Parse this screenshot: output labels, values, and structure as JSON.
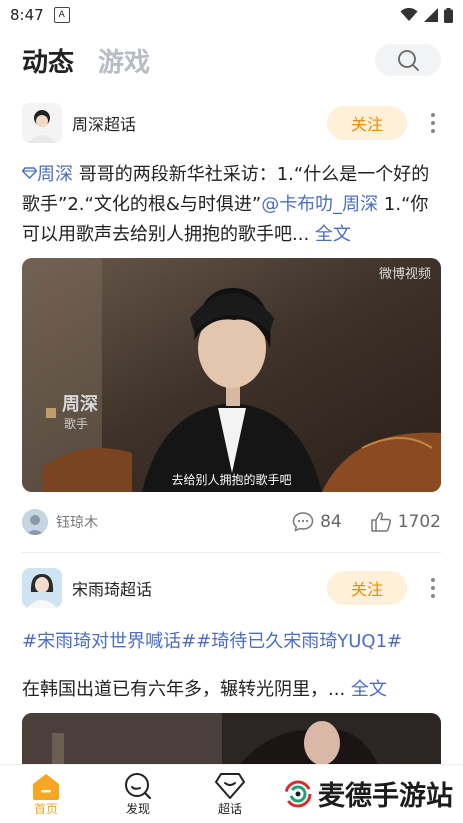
{
  "status_bar": {
    "time": "8:47",
    "app_icon_letter": "A"
  },
  "header": {
    "tab_active": "动态",
    "tab_inactive": "游戏"
  },
  "post1": {
    "author": "周深超话",
    "follow_label": "关注",
    "tag_name": "周深",
    "text_body": " 哥哥的两段新华社采访：1.“什么是一个好的歌手”2.“文化的根&与时俱进”",
    "mention": "@卡布叻_周深",
    "text_tail": " 1.“你可以用歌声去给别人拥抱的歌手吧... ",
    "full_text_label": "全文",
    "video": {
      "watermark": "微博视频",
      "name_caption": "周深",
      "role_caption": "歌手",
      "subtitle": "去给别人拥抱的歌手吧"
    },
    "footer": {
      "commenter": "钰琼木",
      "comments": "84",
      "likes": "1702"
    }
  },
  "post2": {
    "author": "宋雨琦超话",
    "follow_label": "关注",
    "hashtags": "#宋雨琦对世界喊话##琦待已久宋雨琦YUQ1#",
    "text": "在韩国出道已有六年多，辗转光阴里，... ",
    "full_text_label": "全文"
  },
  "bottom_nav": {
    "home": "首页",
    "discover": "发现",
    "supertopic": "超话"
  },
  "watermark": {
    "brand": "麦德手游站"
  },
  "colors": {
    "accent": "#f5a623",
    "link": "#4a6ec8",
    "follow_bg": "#fff1d9",
    "follow_text": "#f08a00"
  }
}
